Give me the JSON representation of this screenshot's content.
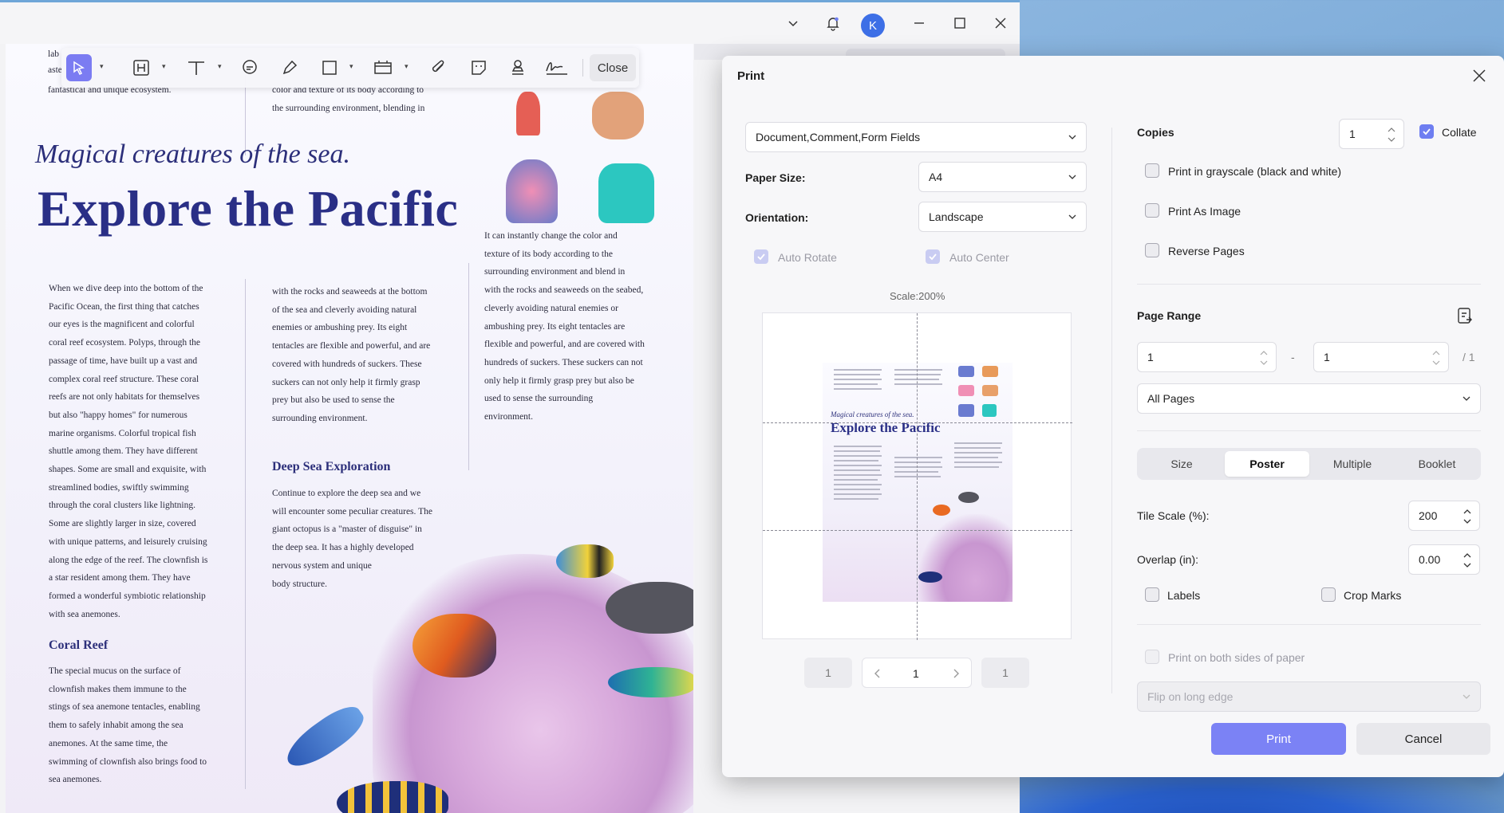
{
  "titlebar": {
    "avatar_letter": "K",
    "icons": [
      "chevron-down-icon",
      "bell-icon",
      "minimize-icon",
      "maximize-icon",
      "close-icon"
    ]
  },
  "toolbar": {
    "tools": [
      "select-icon",
      "text-box-icon",
      "text-icon",
      "comment-icon",
      "highlighter-icon",
      "shape-icon",
      "stamp-bar-icon",
      "attachment-icon",
      "sticker-icon",
      "stamp-icon",
      "signature-icon"
    ],
    "close_label": "Close"
  },
  "document": {
    "top_left_snippet": "fantastical and unique ecosystem.",
    "top_left_fragment1": "lab",
    "top_left_fragment2": "aste",
    "top_mid_line1": "color and texture of its body according to",
    "top_mid_line2": "the surrounding environment, blending in",
    "italic_heading": "Magical creatures of the sea.",
    "main_heading": "Explore the Pacific",
    "col1_lines": [
      "When we dive deep into the bottom of the",
      "Pacific Ocean, the first thing that catches",
      "our eyes is the magnificent and colorful",
      "coral reef ecosystem. Polyps, through the",
      "passage of time, have built up a vast and",
      "complex coral reef structure. These coral",
      "reefs are not only habitats for themselves",
      "but also \"happy homes\" for numerous",
      "marine organisms. Colorful tropical fish",
      "shuttle among them. They have different",
      "shapes. Some are small and exquisite, with",
      "streamlined bodies, swiftly swimming",
      "through the coral clusters like lightning.",
      "Some are slightly larger in size, covered",
      "with unique patterns, and leisurely cruising",
      "along the edge of the reef. The clownfish is",
      "a star resident among them. They have",
      "formed a wonderful symbiotic relationship",
      "with sea anemones."
    ],
    "coral_reef_heading": "Coral Reef",
    "coral_lines": [
      " The special mucus on the surface of",
      "clownfish makes them immune to the",
      "stings of sea anemone tentacles, enabling",
      "them to safely inhabit among the sea",
      "anemones. At the same time, the",
      "swimming of clownfish also brings food to",
      "sea anemones."
    ],
    "col2_lines": [
      "with the rocks and seaweeds at the bottom",
      "of the sea and cleverly avoiding natural",
      "enemies or ambushing prey. Its eight",
      "tentacles are flexible and powerful, and are",
      "covered with hundreds of suckers. These",
      "suckers can not only help it firmly grasp",
      "prey but also be used to sense the",
      "surrounding environment."
    ],
    "deep_sea_heading": "Deep Sea Exploration",
    "deep_lines": [
      "Continue to explore the deep sea and we",
      "will encounter some peculiar creatures. The",
      "giant octopus is a \"master of disguise\" in",
      "the deep sea. It has a highly developed",
      "nervous system and unique",
      "body structure."
    ],
    "col3_lines": [
      "It can instantly change the color and",
      "texture of its body according to the",
      "surrounding environment and blend in",
      "with the rocks and seaweeds on the seabed,",
      "cleverly avoiding natural enemies or",
      "ambushing prey. Its eight tentacles are",
      "flexible and powerful, and are covered with",
      "hundreds of suckers. These suckers can not",
      "only help it firmly grasp prey but also be",
      "used to sense the surrounding",
      "environment."
    ]
  },
  "print": {
    "title": "Print",
    "content_select": "Document,Comment,Form Fields",
    "paper_size_label": "Paper Size:",
    "paper_size_value": "A4",
    "orientation_label": "Orientation:",
    "orientation_value": "Landscape",
    "auto_rotate": "Auto Rotate",
    "auto_center": "Auto Center",
    "scale_label": "Scale:200%",
    "preview_heading_italic": "Magical creatures of the sea.",
    "preview_heading": "Explore the Pacific",
    "pager": {
      "first": "1",
      "current": "1",
      "last": "1"
    },
    "copies_label": "Copies",
    "copies_value": "1",
    "collate": "Collate",
    "grayscale": "Print in grayscale (black and white)",
    "as_image": "Print As Image",
    "reverse": "Reverse Pages",
    "page_range_label": "Page Range",
    "range_from": "1",
    "range_dash": "-",
    "range_to": "1",
    "range_total": "/ 1",
    "pages_select": "All Pages",
    "modes": [
      "Size",
      "Poster",
      "Multiple",
      "Booklet"
    ],
    "active_mode": "Poster",
    "tile_scale_label": "Tile Scale (%):",
    "tile_scale_value": "200",
    "overlap_label": "Overlap (in):",
    "overlap_value": "0.00",
    "labels": "Labels",
    "crop_marks": "Crop Marks",
    "both_sides": "Print on both sides of paper",
    "flip_select": "Flip on long edge",
    "print_button": "Print",
    "cancel_button": "Cancel"
  },
  "colors": {
    "accent": "#7b82f5",
    "heading_blue": "#2a2f86"
  }
}
